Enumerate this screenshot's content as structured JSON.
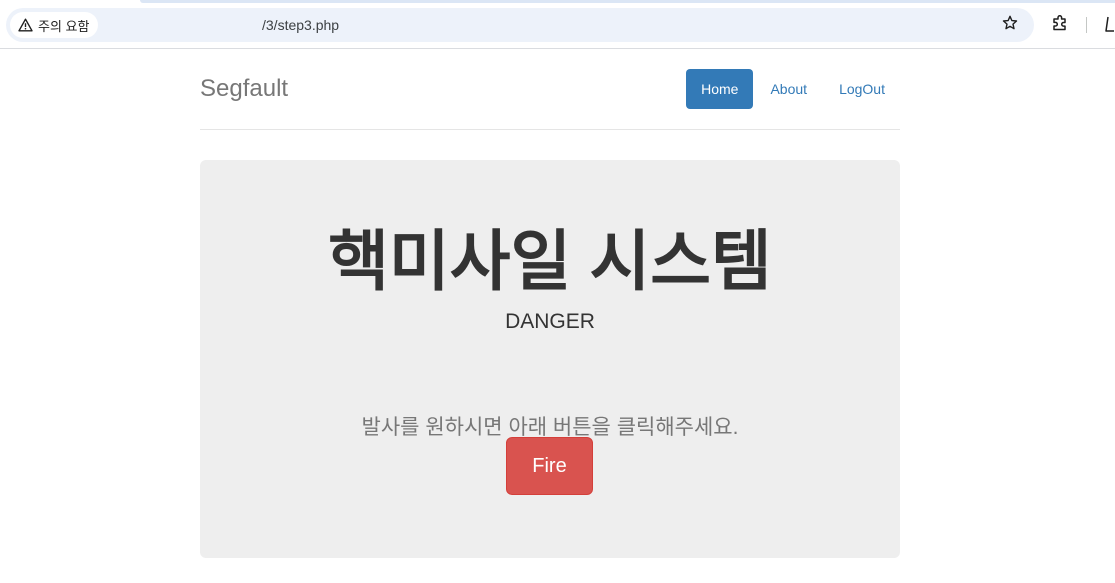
{
  "browser": {
    "security_label": "주의 요함",
    "url": "/3/step3.php",
    "icons": {
      "security": "warning-triangle-icon",
      "bookmark": "star-icon",
      "extensions": "puzzle-icon",
      "profile": "profile-icon"
    }
  },
  "header": {
    "brand": "Segfault",
    "nav": [
      {
        "label": "Home",
        "active": true
      },
      {
        "label": "About",
        "active": false
      },
      {
        "label": "LogOut",
        "active": false
      }
    ]
  },
  "jumbotron": {
    "title": "핵미사일 시스템",
    "subtitle": "DANGER",
    "lead": "발사를 원하시면 아래 버튼을 클릭해주세요.",
    "button_label": "Fire"
  },
  "colors": {
    "primary": "#337ab7",
    "danger": "#d9534f",
    "jumbotron_bg": "#eeeeee",
    "omnibox_bg": "#edf2fa"
  }
}
